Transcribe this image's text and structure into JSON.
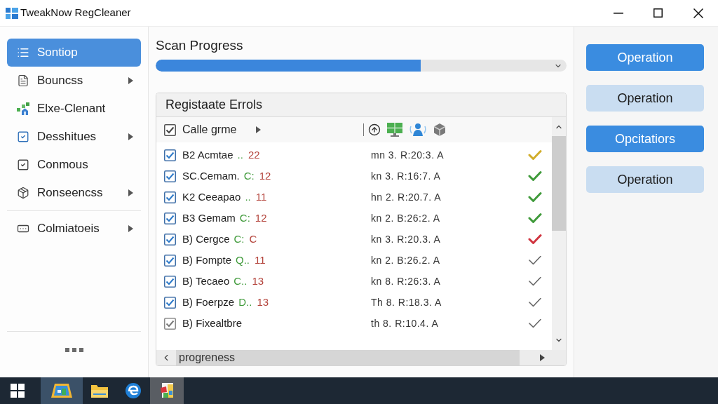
{
  "window": {
    "title": "TweakNow RegCleaner"
  },
  "sidebar": {
    "groups": [
      {
        "items": [
          {
            "label": "Sontiop",
            "selected": true,
            "submenu": false
          },
          {
            "label": "Bouncss",
            "selected": false,
            "submenu": true
          },
          {
            "label": "Elxe-Clenant",
            "selected": false,
            "submenu": false
          },
          {
            "label": "Desshitues",
            "selected": false,
            "submenu": true
          },
          {
            "label": "Conmous",
            "selected": false,
            "submenu": false
          },
          {
            "label": "Ronseencss",
            "selected": false,
            "submenu": true
          }
        ]
      },
      {
        "items": [
          {
            "label": "Colmiatoeis",
            "selected": false,
            "submenu": true
          }
        ]
      }
    ]
  },
  "scan": {
    "title": "Scan Progress",
    "level": 0.645
  },
  "errors": {
    "tab": "Registaate Errols",
    "header": {
      "label": "Calle grme",
      "checked": true
    },
    "rows": [
      {
        "name": "B2 Acmtae",
        "code": "..",
        "count": "22",
        "date": "mn 3. R:20:3. A",
        "checked": true,
        "disabled": false,
        "color": "#d1ad2a"
      },
      {
        "name": "SC.Cemam.",
        "code": "C:",
        "count": "12",
        "date": "kn 3. R:16:7. A",
        "checked": true,
        "disabled": false,
        "color": "#3f9a3a"
      },
      {
        "name": "K2 Ceeapao",
        "code": "..",
        "count": "11",
        "date": "hn 2. R:20.7. A",
        "checked": true,
        "disabled": false,
        "color": "#3f9a3a"
      },
      {
        "name": "B3 Gemam",
        "code": "C:",
        "count": "12",
        "date": "kn 2. B:26:2. A",
        "checked": true,
        "disabled": false,
        "color": "#3f9a3a"
      },
      {
        "name": "B) Cergce",
        "code": "C:",
        "count": "C",
        "date": "kn 3. R:20.3. A",
        "checked": true,
        "disabled": false,
        "color": "#d0343f"
      },
      {
        "name": "B) Fompte",
        "code": "Q..",
        "count": "11",
        "date": "kn 2. B:26.2. A",
        "checked": true,
        "disabled": false,
        "color": "#666666"
      },
      {
        "name": "B) Tecaeo",
        "code": "C..",
        "count": "13",
        "date": "kn 8. R:26:3. A",
        "checked": true,
        "disabled": false,
        "color": "#666666"
      },
      {
        "name": "B) Foerpze",
        "code": "D..",
        "count": "13",
        "date": "Th 8. R:18.3. A",
        "checked": true,
        "disabled": false,
        "color": "#666666"
      },
      {
        "name": "B) Fixealtbre",
        "date": "th 8. R:10.4. A",
        "checked": true,
        "disabled": true,
        "color": "#666666"
      }
    ],
    "scroll_label": "progreness"
  },
  "actions": [
    {
      "label": "Operation",
      "kind": "primary"
    },
    {
      "label": "Operation",
      "kind": "secondary"
    },
    {
      "label": "Opcitatiors",
      "kind": "primary"
    },
    {
      "label": "Operation",
      "kind": "secondary"
    }
  ],
  "taskbar": {
    "apps": [
      {
        "active": true,
        "hovered": false
      },
      {
        "active": false,
        "hovered": false
      },
      {
        "active": false,
        "hovered": false
      },
      {
        "active": false,
        "hovered": true
      }
    ]
  }
}
